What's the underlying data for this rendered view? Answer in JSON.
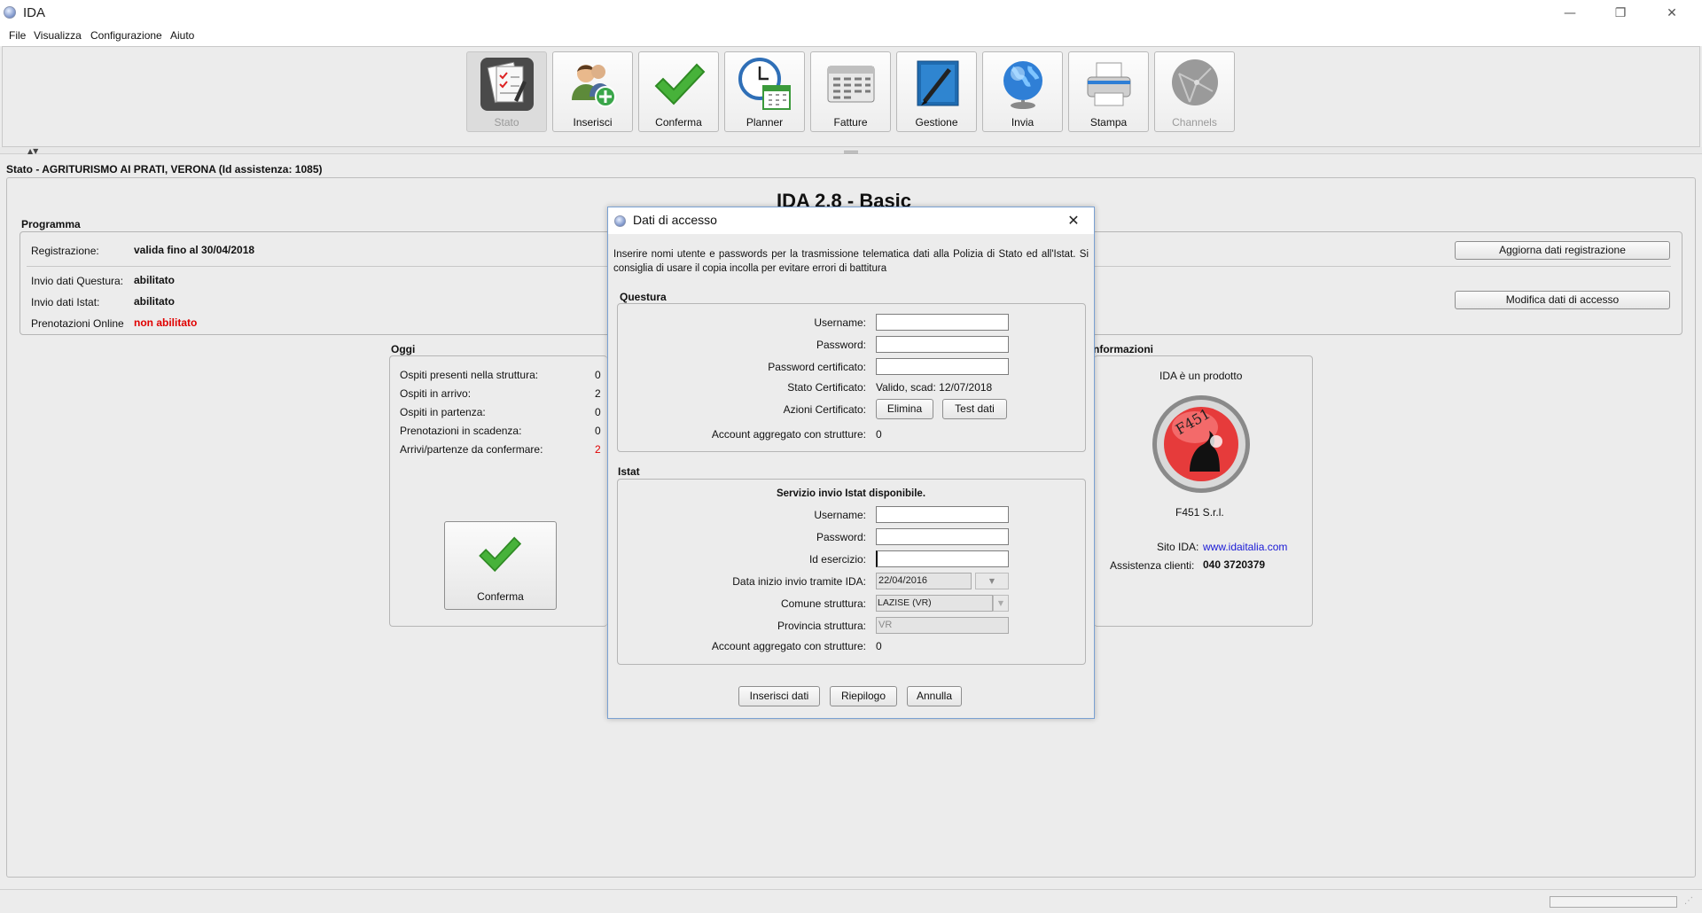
{
  "window": {
    "title": "IDA",
    "minimize": "—",
    "restore": "❐",
    "close": "✕"
  },
  "menu": [
    "File",
    "Visualizza",
    "Configurazione",
    "Aiuto"
  ],
  "toolbar": [
    {
      "label": "Stato",
      "icon": "status-icon",
      "state": "active"
    },
    {
      "label": "Inserisci",
      "icon": "add-user-icon",
      "state": "normal"
    },
    {
      "label": "Conferma",
      "icon": "checkmark-icon",
      "state": "normal"
    },
    {
      "label": "Planner",
      "icon": "planner-icon",
      "state": "normal"
    },
    {
      "label": "Fatture",
      "icon": "invoice-icon",
      "state": "normal"
    },
    {
      "label": "Gestione",
      "icon": "management-icon",
      "state": "normal"
    },
    {
      "label": "Invia",
      "icon": "globe-icon",
      "state": "normal"
    },
    {
      "label": "Stampa",
      "icon": "printer-icon",
      "state": "normal"
    },
    {
      "label": "Channels",
      "icon": "channels-icon",
      "state": "disabled"
    }
  ],
  "status": {
    "title": "Stato - AGRITURISMO AI PRATI, VERONA (Id assistenza: 1085)",
    "heading": "IDA 2.8 - Basic"
  },
  "programma": {
    "title": "Programma",
    "rows": [
      {
        "label": "Registrazione:",
        "value": "valida fino al 30/04/2018"
      },
      {
        "label": "Invio dati Questura:",
        "value": "abilitato"
      },
      {
        "label": "Invio dati Istat:",
        "value": "abilitato"
      },
      {
        "label": "Prenotazioni Online",
        "value": "non abilitato"
      }
    ],
    "btn_update": "Aggiorna dati registrazione",
    "btn_modify": "Modifica dati di accesso"
  },
  "oggi": {
    "title": "Oggi",
    "rows": [
      {
        "label": "Ospiti presenti nella struttura:",
        "value": "0"
      },
      {
        "label": "Ospiti in arrivo:",
        "value": "2"
      },
      {
        "label": "Ospiti in partenza:",
        "value": "0"
      },
      {
        "label": "Prenotazioni in scadenza:",
        "value": "0"
      },
      {
        "label": "Arrivi/partenze da confermare:",
        "value": "2"
      }
    ],
    "confirm_button": "Conferma"
  },
  "info": {
    "title": "nformazioni",
    "product_line": "IDA è un prodotto",
    "company": "F451 S.r.l.",
    "logo_text": "F451",
    "site_label": "Sito IDA:",
    "site_value": "www.idaitalia.com",
    "support_label": "Assistenza clienti:",
    "support_value": "040 3720379"
  },
  "dialog": {
    "title": "Dati di accesso",
    "close": "✕",
    "intro": "Inserire nomi utente e passwords per la trasmissione telematica dati alla Polizia di Stato ed all'Istat. Si consiglia di usare il copia incolla per evitare errori di battitura",
    "questura": {
      "title": "Questura",
      "username_label": "Username:",
      "password_label": "Password:",
      "cert_password_label": "Password certificato:",
      "cert_state_label": "Stato Certificato:",
      "cert_state_value": "Valido, scad: 12/07/2018",
      "cert_actions_label": "Azioni Certificato:",
      "btn_delete": "Elimina",
      "btn_test": "Test dati",
      "aggregate_label": "Account aggregato con strutture:",
      "aggregate_value": "0"
    },
    "istat": {
      "title": "Istat",
      "service_text": "Servizio invio Istat disponibile.",
      "username_label": "Username:",
      "password_label": "Password:",
      "exercise_label": "Id esercizio:",
      "start_date_label": "Data inizio invio tramite IDA:",
      "start_date_value": "22/04/2016",
      "comune_label": "Comune struttura:",
      "comune_value": "LAZISE (VR)",
      "provincia_label": "Provincia struttura:",
      "provincia_value": "VR",
      "aggregate_label": "Account aggregato con strutture:",
      "aggregate_value": "0"
    },
    "btn_insert": "Inserisci dati",
    "btn_summary": "Riepilogo",
    "btn_cancel": "Annulla"
  }
}
